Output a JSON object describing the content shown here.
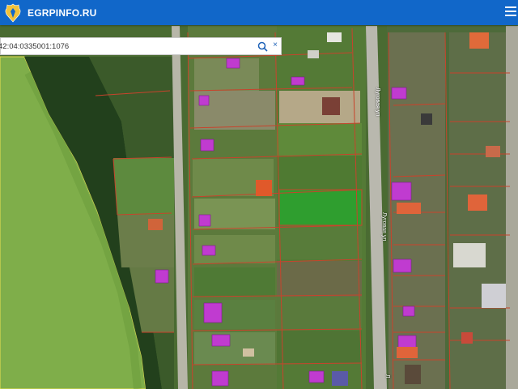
{
  "header": {
    "brand": "EGRPINFO.RU",
    "logo_icon": "coat-of-arms-icon",
    "menu_icon": "hamburger-menu-icon",
    "color": "#1167c9"
  },
  "search": {
    "value": "42:04:0335001:1076",
    "search_icon": "magnifier-icon",
    "clear_label": "×"
  },
  "map": {
    "road_labels": [
      "Луговая ул",
      "Луговая ул",
      "Л"
    ],
    "selected_parcel_color": "#2f9e2f",
    "boundary_color": "#c8432c"
  }
}
